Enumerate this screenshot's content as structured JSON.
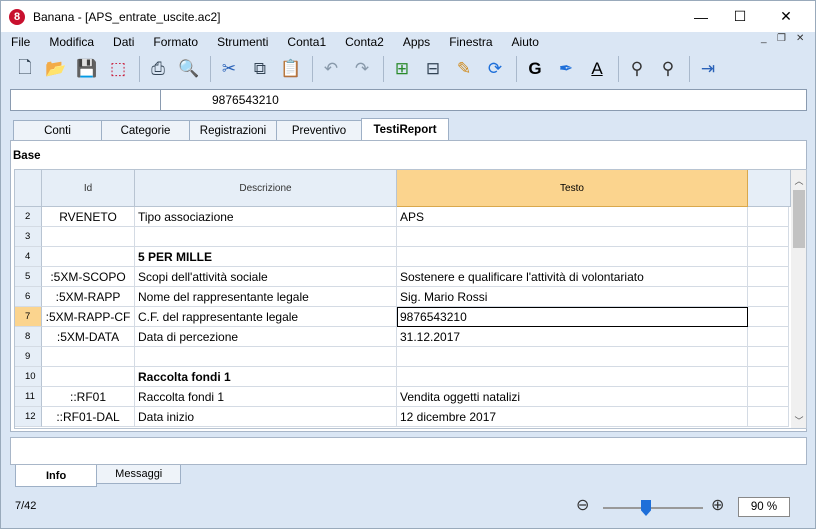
{
  "window": {
    "title": "Banana - [APS_entrate_uscite.ac2]"
  },
  "menu": [
    "File",
    "Modifica",
    "Dati",
    "Formato",
    "Strumenti",
    "Conta1",
    "Conta2",
    "Apps",
    "Finestra",
    "Aiuto"
  ],
  "formula_bar": {
    "cell_ref": "",
    "value": "9876543210"
  },
  "tabs": [
    "Conti",
    "Categorie",
    "Registrazioni",
    "Preventivo",
    "TestiReport"
  ],
  "active_tab": "TestiReport",
  "view_name": "Base",
  "columns": {
    "id": "Id",
    "desc": "Descrizione",
    "testo": "Testo"
  },
  "rows": [
    {
      "n": "2",
      "id": "RVENETO",
      "desc": "Tipo associazione",
      "testo": "APS",
      "bold": false
    },
    {
      "n": "3",
      "id": "",
      "desc": "",
      "testo": "",
      "bold": false
    },
    {
      "n": "4",
      "id": "",
      "desc": "5 PER MILLE",
      "testo": "",
      "bold": true
    },
    {
      "n": "5",
      "id": ":5XM-SCOPO",
      "desc": "Scopi dell'attività sociale",
      "testo": "Sostenere e qualificare l'attività di volontariato",
      "bold": false
    },
    {
      "n": "6",
      "id": ":5XM-RAPP",
      "desc": "Nome del rappresentante legale",
      "testo": "Sig. Mario Rossi",
      "bold": false
    },
    {
      "n": "7",
      "id": ":5XM-RAPP-CF",
      "desc": "C.F. del rappresentante legale",
      "testo": "9876543210",
      "bold": false
    },
    {
      "n": "8",
      "id": ":5XM-DATA",
      "desc": "Data di percezione",
      "testo": "31.12.2017",
      "bold": false
    },
    {
      "n": "9",
      "id": "",
      "desc": "",
      "testo": "",
      "bold": false
    },
    {
      "n": "10",
      "id": "",
      "desc": "Raccolta fondi 1",
      "testo": "",
      "bold": true
    },
    {
      "n": "11",
      "id": "::RF01",
      "desc": "Raccolta fondi 1",
      "testo": "Vendita oggetti natalizi",
      "bold": false
    },
    {
      "n": "12",
      "id": "::RF01-DAL",
      "desc": "Data inizio",
      "testo": "12 dicembre 2017",
      "bold": false
    }
  ],
  "bottom_tabs": [
    "Info",
    "Messaggi"
  ],
  "status": {
    "position": "7/42",
    "zoom": "90 %"
  },
  "icons": [
    "new-file-icon",
    "open-icon",
    "save-icon",
    "pdf-icon",
    "print-icon",
    "print-preview-icon",
    "cut-icon",
    "copy-icon",
    "paste-icon",
    "undo-icon",
    "redo-icon",
    "add-rows-icon",
    "delete-rows-icon",
    "edit-icon",
    "recalculate-icon",
    "bold-icon",
    "highlight-icon",
    "font-color-icon",
    "search-icon",
    "search-next-icon",
    "layout-icon"
  ],
  "colors": {
    "accent": "#fbd48e",
    "pdf": "#c8102e",
    "zoom_knob": "#1e6fd9"
  }
}
